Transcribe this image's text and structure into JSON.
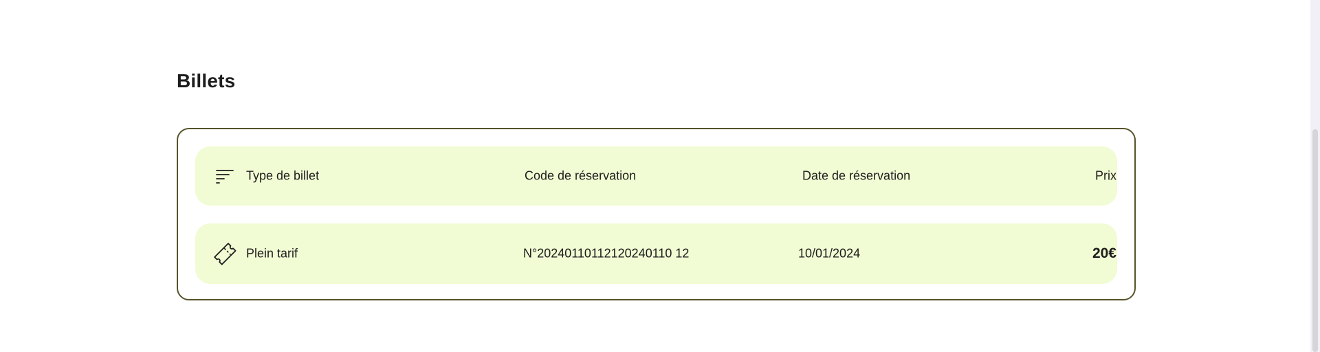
{
  "section": {
    "title": "Billets"
  },
  "table": {
    "headers": {
      "type": "Type de billet",
      "code": "Code de réservation",
      "date": "Date de réservation",
      "price": "Prix"
    },
    "rows": [
      {
        "type": "Plein tarif",
        "code": "N°20240110112120240110 12",
        "date": "10/01/2024",
        "price": "20€"
      }
    ]
  },
  "icons": {
    "header": "sort-icon",
    "row": "ticket-icon"
  },
  "colors": {
    "row_background": "#f1fbd4",
    "card_border": "#55532a",
    "text": "#1d1d1b"
  }
}
